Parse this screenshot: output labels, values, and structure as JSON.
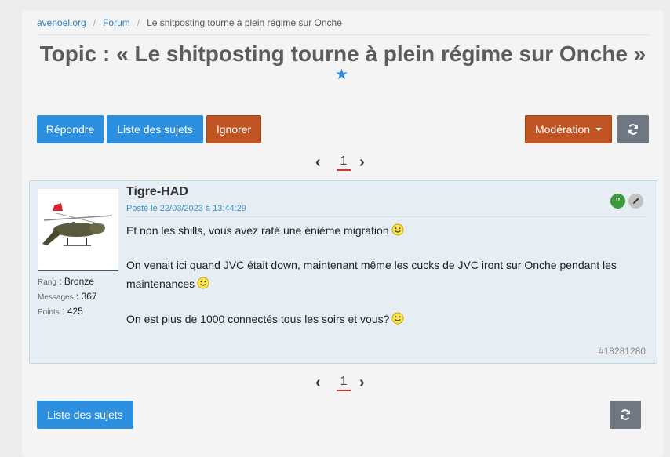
{
  "breadcrumb": {
    "items": [
      "avenoel.org",
      "Forum"
    ],
    "current": "Le shitposting tourne à plein régime sur Onche",
    "separator": "/"
  },
  "page_title": "Topic : « Le shitposting tourne à plein régime sur Onche »",
  "favorite_star": "★",
  "toolbar": {
    "reply_label": "Répondre",
    "topics_list_label": "Liste des sujets",
    "ignore_label": "Ignorer",
    "moderation_label": "Modération",
    "refresh_icon": "refresh-icon"
  },
  "pagination": {
    "prev": "‹",
    "next": "›",
    "current_page": "1"
  },
  "post": {
    "author": "Tigre-HAD",
    "posted_at": "Posté le 22/03/2023 à 13:44:29",
    "rank_label": "Rang",
    "rank_value": "Bronze",
    "messages_label": "Messages",
    "messages_value": "367",
    "points_label": "Points",
    "points_value": "425",
    "lines": [
      "Et non les shills, vous avez raté une énième migration",
      "On venait ici quand JVC était down, maintenant même les cucks de JVC iront sur Onche pendant les",
      "maintenances",
      "On est plus de 1000 connectés tous les soirs et vous?"
    ],
    "message_id": "#18281280",
    "quote_glyph": "”"
  },
  "bottom_bar": {
    "topics_list_label": "Liste des sujets"
  },
  "colors": {
    "accent_blue": "#2d8fe0",
    "accent_orange": "#c05423",
    "gray_button": "#6f7782",
    "post_bg": "#e6eef4",
    "page_underline": "#d9322b"
  }
}
